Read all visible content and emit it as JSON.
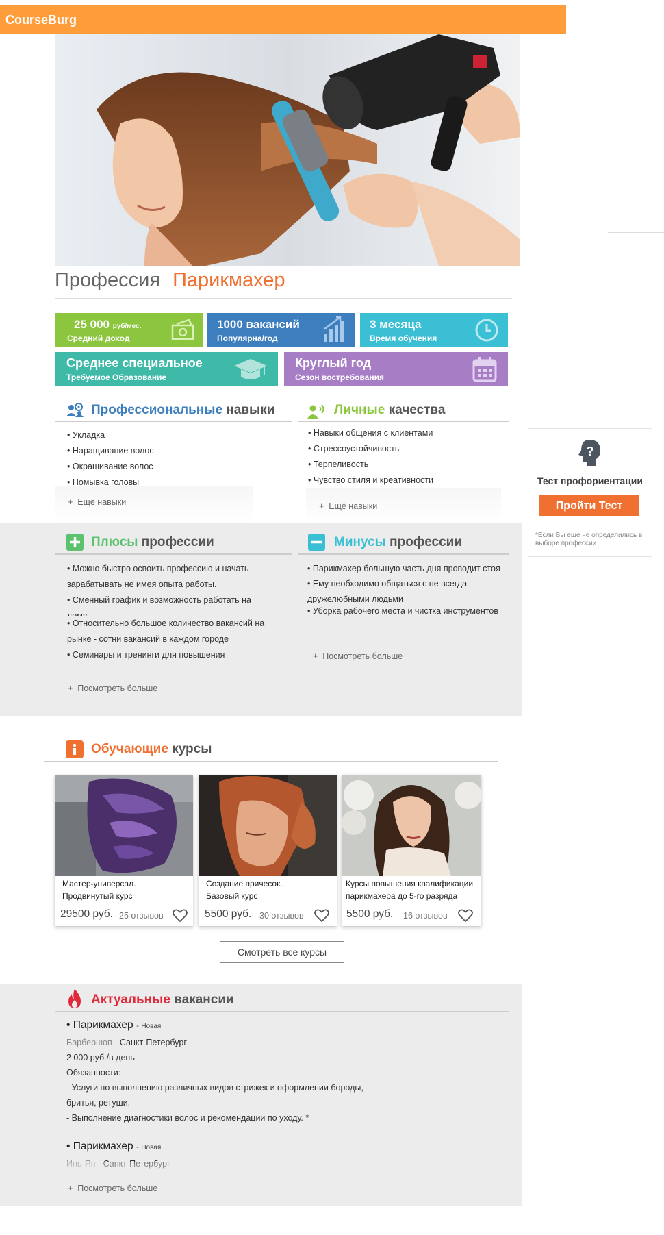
{
  "header": {
    "brand": "CourseBurg"
  },
  "title": {
    "prefix": "Профессия",
    "accent": "Парикмахер"
  },
  "stats": {
    "income": {
      "value": "25 000",
      "unit": "руб/мес.",
      "label": "Средний доход"
    },
    "vacancies": {
      "value": "1000 вакансий",
      "label": "Популярна/год"
    },
    "duration": {
      "value": "3 месяца",
      "label": "Время обучения"
    },
    "education": {
      "value": "Среднее  специальное",
      "label": "Требуемое Образование"
    },
    "season": {
      "value": "Круглый год",
      "label": "Сезон востребования"
    }
  },
  "skills": {
    "pro": {
      "title_accent": "Профессиональные",
      "title_rest": "навыки",
      "items": [
        "Укладка",
        "Наращивание волос",
        "Окрашивание волос",
        "Помывка головы"
      ],
      "more": "Ещё навыки"
    },
    "personal": {
      "title_accent": "Личные",
      "title_rest": "качества",
      "items": [
        "Навыки общения с клиентами",
        "Стрессоустойчивость",
        "Терпеливость",
        "Чувство стиля и креативности"
      ],
      "more": "Ещё навыки"
    }
  },
  "pros": {
    "title_accent": "Плюсы",
    "title_rest": "профессии",
    "items": [
      "• Можно быстро освоить профессию и начать зарабатывать не имея опыта работы.",
      "• Сменный график и возможность работать на дому",
      "• Относительно большое количество вакансий на рынке - сотни вакансий в каждом городе",
      "• Семинары и тренинги для повышения"
    ],
    "more": "Посмотреть больше"
  },
  "cons": {
    "title_accent": "Минусы",
    "title_rest": "профессии",
    "items": [
      "• Парикмахер большую часть дня проводит стоя",
      "•  Ему необходимо общаться с не всегда дружелюбными людьми",
      "• Уборка рабочего места и чистка инструментов"
    ],
    "more": "Посмотреть больше"
  },
  "test": {
    "label": "Тест профориентации",
    "button": "Пройти Тест",
    "note": "*Если Вы еще не определились в выборе профессии"
  },
  "courses": {
    "title_accent": "Обучающие",
    "title_rest": "курсы",
    "items": [
      {
        "line1": "Мастер-универсал.",
        "line2": "Продвинутый курс",
        "price": "29500 руб.",
        "reviews": "25 отзывов"
      },
      {
        "line1": "Создание причесок.",
        "line2": "Базовый курс",
        "price": "5500 руб.",
        "reviews": "30 отзывов"
      },
      {
        "line1": "Курсы повышения квалификации",
        "line2": "парикмахера до 5-го разряда",
        "price": "5500 руб.",
        "reviews": "16 отзывов"
      }
    ],
    "all_button": "Смотреть все курсы"
  },
  "vacancies": {
    "title_accent": "Актуальные",
    "title_rest": "вакансии",
    "items": [
      {
        "title": "Парикмахер",
        "badge": "Новая",
        "company": "Барбершоп",
        "city": "Санкт-Петербург",
        "salary": "2 000 руб./в день",
        "duties_label": "Обязанности:",
        "duty1": "- Услуги по выполнению различных видов стрижек и оформлении бороды,",
        "duty1b": "бритья, ретуши.",
        "duty2": "-  Выполнение диагностики волос и рекомендации по уходу. *"
      },
      {
        "title": "Парикмахер",
        "badge": "Новая",
        "company": "Инь-Ян",
        "city": "Санкт-Петербург"
      }
    ],
    "more": "Посмотреть больше"
  },
  "colors": {
    "header": "#ff9d3a",
    "accent_orange": "#ef7030",
    "green": "#8cc63f",
    "blue": "#3d7ebf",
    "cyan": "#3bbfd4",
    "teal": "#3fb9a8",
    "purple": "#a77dc6",
    "red": "#e02a3c"
  }
}
